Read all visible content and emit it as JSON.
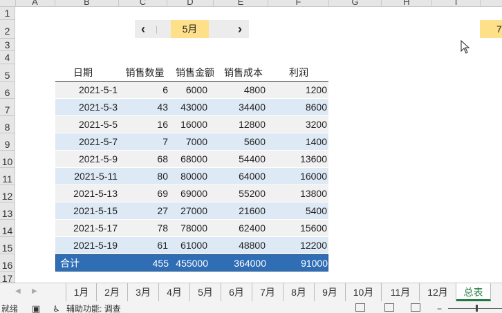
{
  "columns": [
    "A",
    "B",
    "C",
    "D",
    "E",
    "F",
    "G",
    "H",
    "I"
  ],
  "rows": [
    "1",
    "2",
    "3",
    "4",
    "5",
    "6",
    "7",
    "8",
    "9",
    "10",
    "11",
    "12",
    "13",
    "14",
    "15",
    "16",
    "17"
  ],
  "selector": {
    "prev": "‹",
    "sep": "|",
    "month": "5月",
    "next": "›",
    "side_value": "7"
  },
  "table": {
    "headers": [
      "日期",
      "销售数量",
      "销售金额",
      "销售成本",
      "利润"
    ],
    "rows": [
      [
        "2021-5-1",
        "6",
        "6000",
        "4800",
        "1200"
      ],
      [
        "2021-5-3",
        "43",
        "43000",
        "34400",
        "8600"
      ],
      [
        "2021-5-5",
        "16",
        "16000",
        "12800",
        "3200"
      ],
      [
        "2021-5-7",
        "7",
        "7000",
        "5600",
        "1400"
      ],
      [
        "2021-5-9",
        "68",
        "68000",
        "54400",
        "13600"
      ],
      [
        "2021-5-11",
        "80",
        "80000",
        "64000",
        "16000"
      ],
      [
        "2021-5-13",
        "69",
        "69000",
        "55200",
        "13800"
      ],
      [
        "2021-5-15",
        "27",
        "27000",
        "21600",
        "5400"
      ],
      [
        "2021-5-17",
        "78",
        "78000",
        "62400",
        "15600"
      ],
      [
        "2021-5-19",
        "61",
        "61000",
        "48800",
        "12200"
      ]
    ],
    "total": [
      "合计",
      "455",
      "455000",
      "364000",
      "91000"
    ]
  },
  "sheet_tabs": [
    "1月",
    "2月",
    "3月",
    "4月",
    "5月",
    "6月",
    "7月",
    "8月",
    "9月",
    "10月",
    "11月",
    "12月",
    "总表"
  ],
  "active_tab": "总表",
  "status": {
    "ready": "就绪",
    "accessibility": "辅助功能: 调查"
  },
  "colors": {
    "accent": "#1f7a3d",
    "total_fill": "#2f6db5",
    "month_fill": "#ffe08a",
    "row_alt": "#dde9f5"
  }
}
